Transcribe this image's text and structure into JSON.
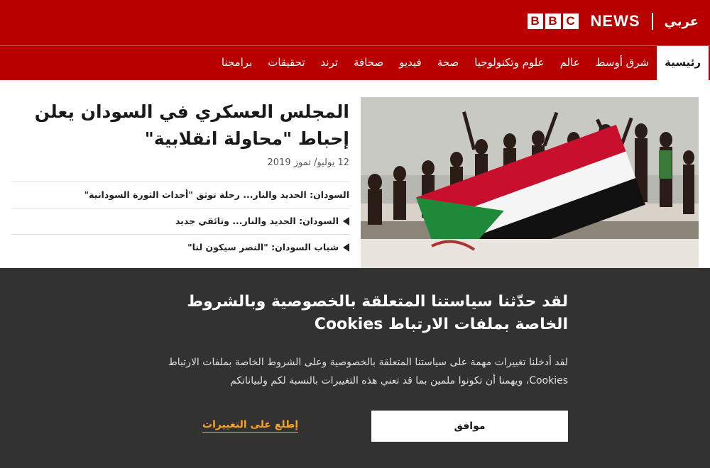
{
  "header": {
    "bbc_letters": [
      "B",
      "B",
      "C"
    ],
    "news_word": "NEWS",
    "service_name": "عربي",
    "brand_color": "#b80000"
  },
  "nav": {
    "items": [
      {
        "label": "رئيسية",
        "active": true
      },
      {
        "label": "شرق أوسط"
      },
      {
        "label": "عالم"
      },
      {
        "label": "علوم وتكنولوجيا"
      },
      {
        "label": "صحة"
      },
      {
        "label": "فيديو"
      },
      {
        "label": "صحافة"
      },
      {
        "label": "ترند"
      },
      {
        "label": "تحقيقات"
      },
      {
        "label": "برامجنا"
      }
    ]
  },
  "article": {
    "headline": "المجلس العسكري في السودان يعلن إحباط \"محاولة انقلابية\"",
    "date": "12 يوليو/ تموز 2019",
    "image_icon": "photo-of-crowd-with-sudan-flag",
    "related": [
      {
        "title": "السودان: الحديد والنار... رحلة توثق \"أحداث الثورة السودانية\"",
        "video": false
      },
      {
        "title": "السودان: الحديد والنار... وثائقي جديد",
        "video": true
      },
      {
        "title": "شباب السودان: \"النصر سيكون لنا\"",
        "video": true
      }
    ]
  },
  "cookie_banner": {
    "title": "لقد حدّثنا سياستنا المتعلقة بالخصوصية وبالشروط الخاصة بملفات الارتباط Cookies",
    "body": "لقد أدخلنا تغييرات مهمة على سياستنا المتعلقة بالخصوصية وعلى الشروط الخاصة بملفات الارتباط Cookies، ويهمنا أن تكونوا ملمين بما قد تعني هذه التغييرات بالنسبة لكم ولبياناتكم",
    "agree_label": "موافق",
    "learn_label": "إطلع على التغييرات",
    "background_color": "#323232",
    "link_color": "#ffa220"
  }
}
